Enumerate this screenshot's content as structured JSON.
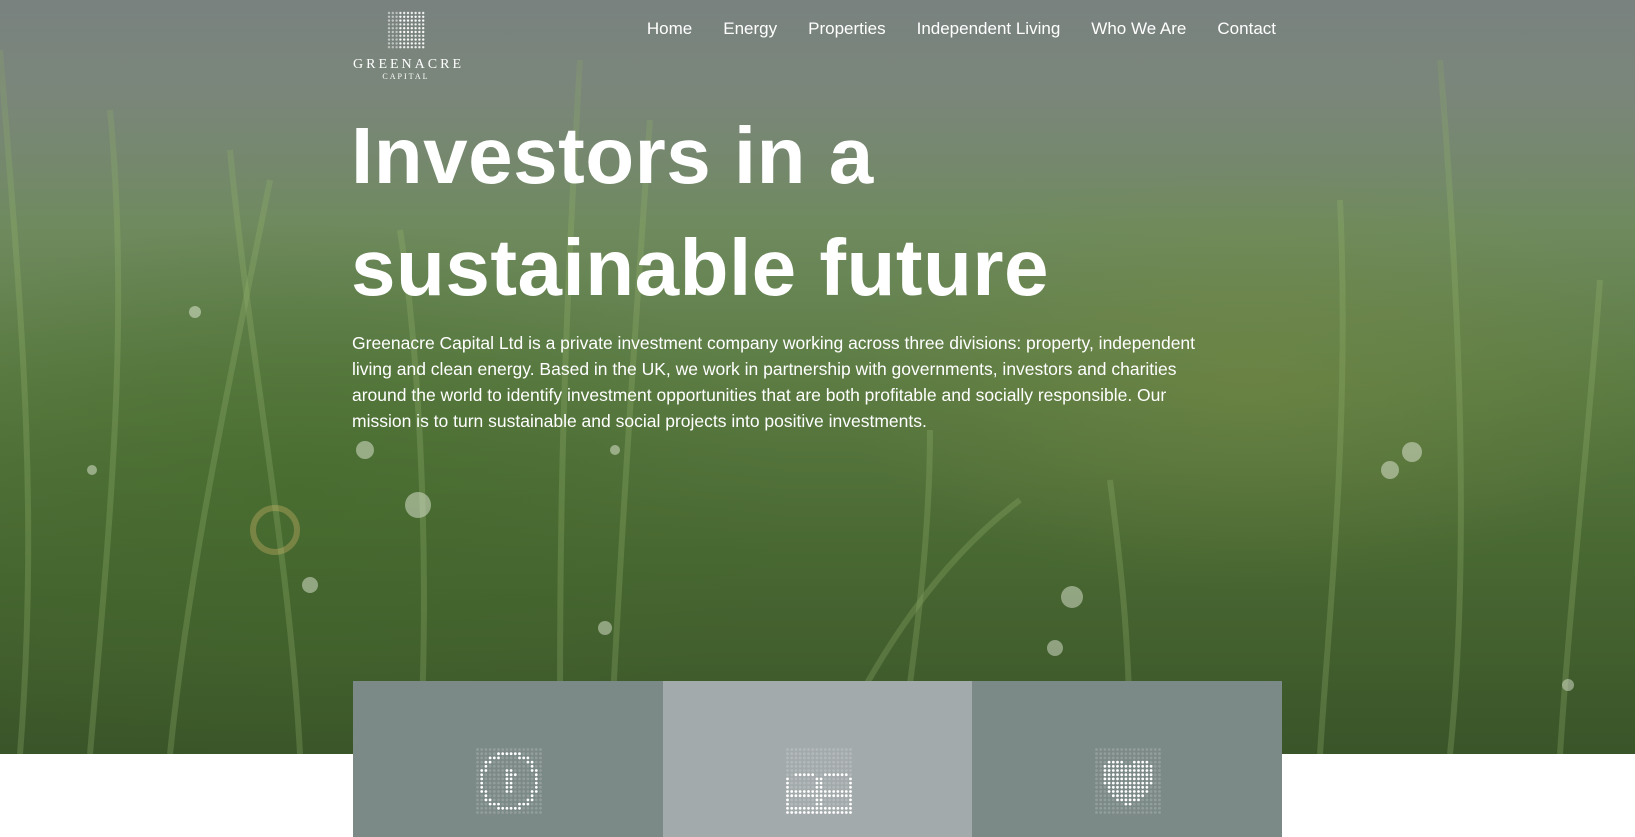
{
  "brand": {
    "name": "GREENACRE",
    "tagline": "CAPITAL"
  },
  "nav": {
    "items": [
      "Home",
      "Energy",
      "Properties",
      "Independent Living",
      "Who We Are",
      "Contact"
    ]
  },
  "hero": {
    "headline_line1": "Investors in a",
    "headline_line2": "sustainable future",
    "intro": "Greenacre Capital Ltd is a private investment company working across three divisions: property, independent living and clean energy. Based in the UK, we work in partnership with governments, investors and charities around the world to identify investment opportunities that are both profitable and socially responsible. Our mission is to turn sustainable and social projects into positive investments."
  },
  "divisions": [
    {
      "icon": "energy-icon",
      "color": "#7b8987"
    },
    {
      "icon": "properties-icon",
      "color": "#a3aaab"
    },
    {
      "icon": "heart-icon",
      "color": "#7b8987"
    }
  ]
}
